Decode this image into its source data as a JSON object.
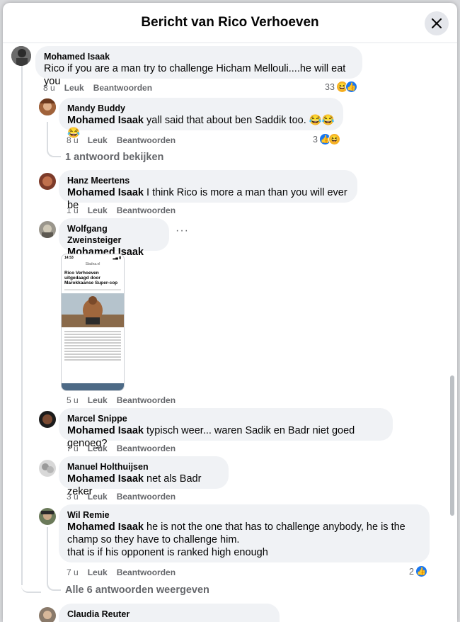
{
  "header": {
    "title": "Bericht van Rico Verhoeven"
  },
  "comments": [
    {
      "author": "Mohamed Isaak",
      "text": "Rico if you are a man try to challenge Hicham Mellouli....he will eat you",
      "time": "8 u",
      "like": "Leuk",
      "reply": "Beantwoorden",
      "reactions": "33"
    },
    {
      "author": "Mandy Buddy",
      "mention": "Mohamed Isaak",
      "text": " yall said that about ben Saddik too. 😂😂😂",
      "time": "8 u",
      "like": "Leuk",
      "reply": "Beantwoorden",
      "reactions": "3",
      "view_replies": "1 antwoord bekijken"
    },
    {
      "author": "Hanz Meertens",
      "mention": "Mohamed Isaak",
      "text": " I think Rico is more a man than you will ever be",
      "time": "1 u",
      "like": "Leuk",
      "reply": "Beantwoorden"
    },
    {
      "author": "Wolfgang Zweinsteiger",
      "mention": "Mohamed Isaak",
      "time": "5 u",
      "like": "Leuk",
      "reply": "Beantwoorden",
      "more": "···",
      "image": {
        "status_time": "14:53",
        "site": "Sladna.nl",
        "headline": "Rico Verhoeven uitgedaagd door Marokkaanse Super-cop"
      }
    },
    {
      "author": "Marcel Snippe",
      "mention": "Mohamed Isaak",
      "text": " typisch weer... waren Sadik en Badr niet goed genoeg?",
      "time": "7 u",
      "like": "Leuk",
      "reply": "Beantwoorden"
    },
    {
      "author": "Manuel Holthuijsen",
      "mention": "Mohamed Isaak",
      "text": " net als Badr zeker",
      "time": "3 u",
      "like": "Leuk",
      "reply": "Beantwoorden"
    },
    {
      "author": "Wil Remie",
      "mention": "Mohamed Isaak",
      "text_line1": " he is not the one that has to challenge anybody, he is the",
      "text_line2": "champ so they have to challenge him.",
      "text_line3": "that is if his opponent is ranked high enough",
      "time": "7 u",
      "like": "Leuk",
      "reply": "Beantwoorden",
      "reactions": "2",
      "view_replies": "Alle 6 antwoorden weergeven"
    },
    {
      "author": "Claudia Reuter"
    }
  ],
  "colors": {
    "like": "#1877f2",
    "bubble": "#f0f2f5",
    "muted": "#65676b"
  }
}
